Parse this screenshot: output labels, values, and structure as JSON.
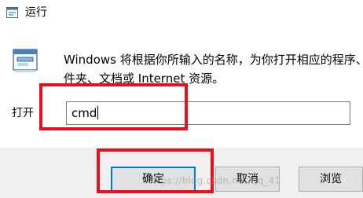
{
  "window": {
    "title": "运行",
    "title_icon": "run-dialog-icon"
  },
  "content": {
    "app_icon": "run-program-icon",
    "description_line1": "Windows 将根据你所输入的名称，为你打开相应的程序、",
    "description_line2": "件夹、文档或 Internet 资源。"
  },
  "open_field": {
    "label": "打开",
    "value": "cmd"
  },
  "buttons": {
    "ok": "确定",
    "cancel": "取消",
    "browse": "浏览"
  },
  "watermark": "https://blog.csdn.net/qq_41"
}
